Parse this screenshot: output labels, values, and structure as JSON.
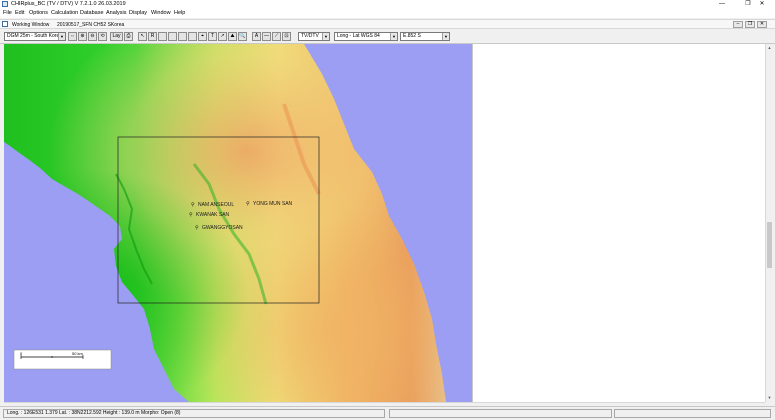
{
  "app": {
    "title": "CHIRplus_BC (TV / DTV)  V 7.2.1.0  26.03.2019",
    "minimize": "—",
    "restore": "❐",
    "close": "✕"
  },
  "menu": [
    "File",
    "Edit",
    "Options",
    "Calculation",
    "Database",
    "Analysis",
    "Display",
    "Window",
    "Help"
  ],
  "mdi": {
    "window_label": "Working Window",
    "document": "20190517_SFN CH52 SKorea",
    "buttons": [
      "–",
      "❐",
      "✕"
    ]
  },
  "toolbar": {
    "dem_select": "DGM 25m - South Korea",
    "service_select": "TV/DTV",
    "coord_select": "Long - Lat   WGS 84",
    "extra_select": "E.852 S",
    "buttons": [
      "⇔",
      "⊕",
      "⊖",
      "⟲",
      "Lay",
      "⎙",
      "↖",
      "R",
      "",
      "",
      "",
      "",
      "⌖",
      "T",
      "↗",
      "⛰",
      "🔍",
      "A",
      "—",
      "⟋",
      "⊡"
    ]
  },
  "map": {
    "sea_color": "#9b9ef2",
    "stations": [
      {
        "name": "NAM ANSEOUL"
      },
      {
        "name": "YONG MUN SAN"
      },
      {
        "name": "KWANAK SAN"
      },
      {
        "name": "GWANGGYOSAN"
      }
    ],
    "scale": {
      "start": "0",
      "end": "50 km"
    }
  },
  "status": {
    "text": "Long. : 126E531 1.379 Lat. : 38N2212.592   Height : 139.0 m   Morpho: Open (8)"
  }
}
